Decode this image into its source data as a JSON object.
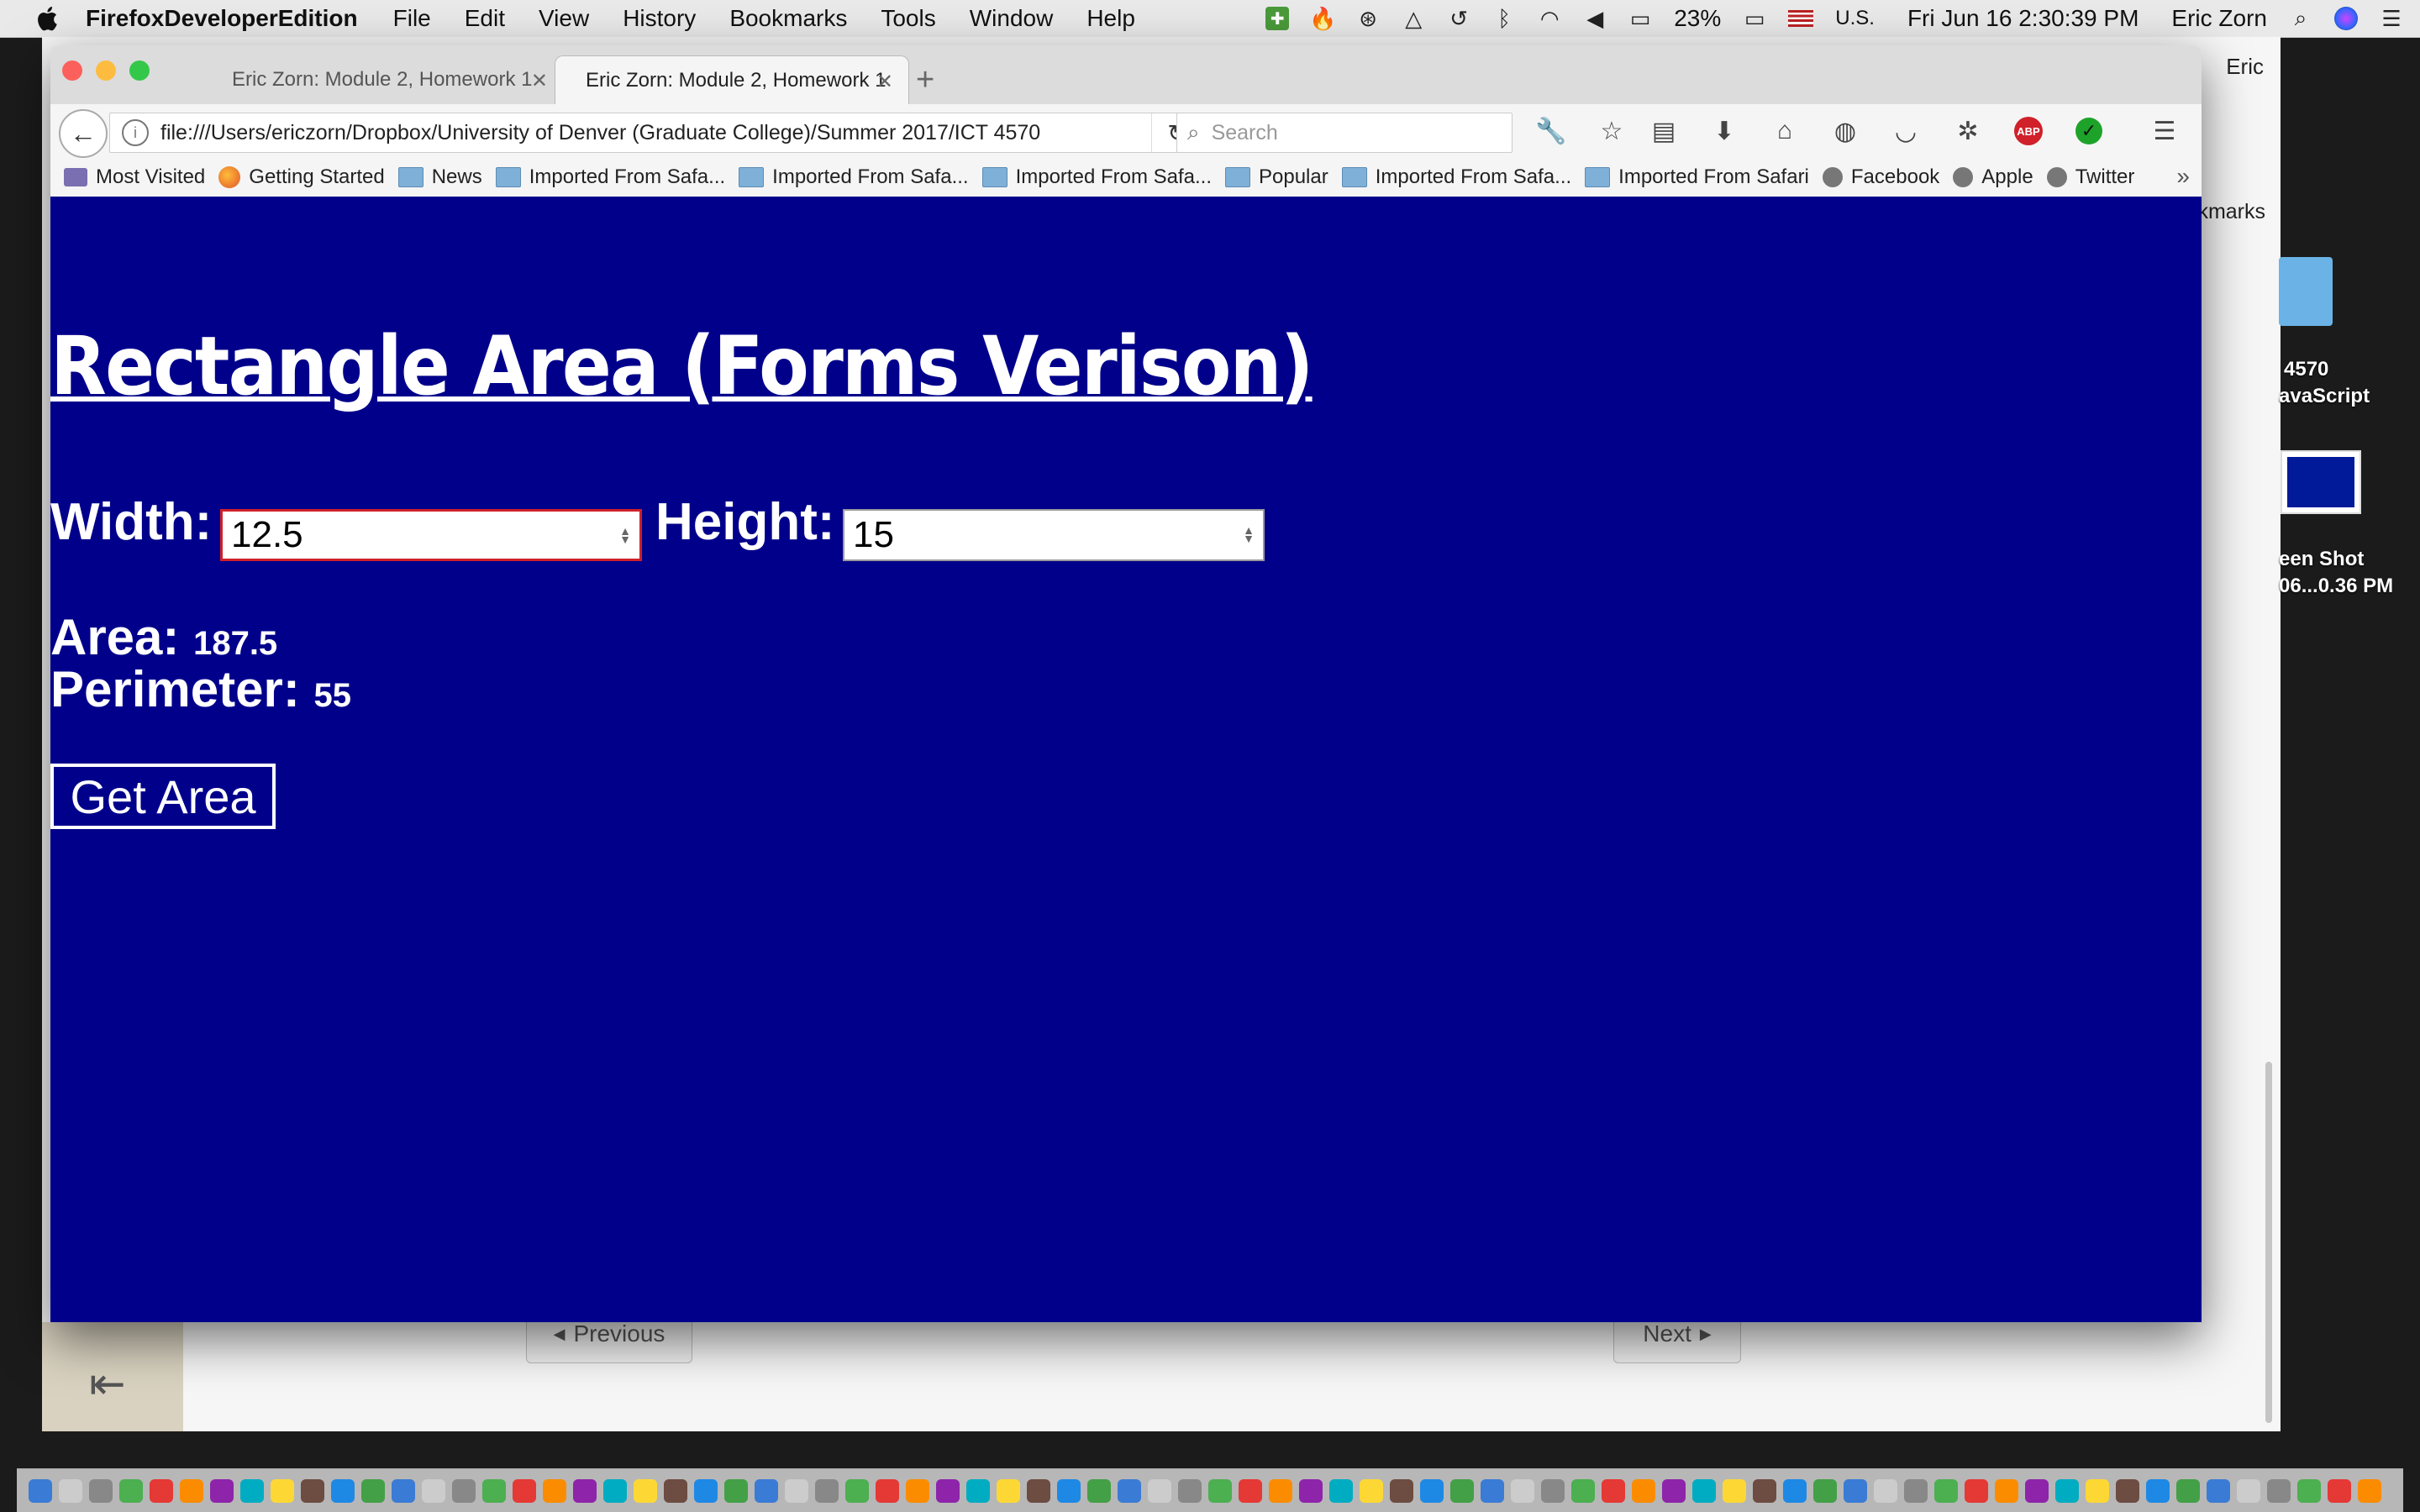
{
  "menubar": {
    "app_name": "FirefoxDeveloperEdition",
    "menus": [
      "File",
      "Edit",
      "View",
      "History",
      "Bookmarks",
      "Tools",
      "Window",
      "Help"
    ],
    "battery": "23%",
    "input_source": "U.S.",
    "clock": "Fri Jun 16  2:30:39 PM",
    "user": "Eric Zorn"
  },
  "background_window": {
    "title": "Eric",
    "bookmarks_partial": "kmarks",
    "previous_label": "Previous",
    "next_label": "Next",
    "sidebar_collapse_icon": "collapse-left-icon"
  },
  "desktop": {
    "folder_label_line1": "4570",
    "folder_label_line2": "avaScript",
    "screenshot_label_line1": "een Shot",
    "screenshot_label_line2": "06...0.36 PM"
  },
  "browser": {
    "tabs": [
      {
        "title": "Eric Zorn: Module 2, Homework 1",
        "active": false
      },
      {
        "title": "Eric Zorn: Module 2, Homework 1",
        "active": true
      }
    ],
    "url": "file:///Users/ericzorn/Dropbox/University of Denver (Graduate College)/Summer 2017/ICT 4570",
    "search_placeholder": "Search",
    "bookmarks": [
      {
        "label": "Most Visited",
        "icon": "most-visited-icon"
      },
      {
        "label": "Getting Started",
        "icon": "firefox-icon"
      },
      {
        "label": "News",
        "icon": "folder-icon"
      },
      {
        "label": "Imported From Safa...",
        "icon": "folder-icon"
      },
      {
        "label": "Imported From Safa...",
        "icon": "folder-icon"
      },
      {
        "label": "Imported From Safa...",
        "icon": "folder-icon"
      },
      {
        "label": "Popular",
        "icon": "folder-icon"
      },
      {
        "label": "Imported From Safa...",
        "icon": "folder-icon"
      },
      {
        "label": "Imported From Safari",
        "icon": "folder-icon"
      },
      {
        "label": "Facebook",
        "icon": "globe-icon"
      },
      {
        "label": "Apple",
        "icon": "globe-icon"
      },
      {
        "label": "Twitter",
        "icon": "globe-icon"
      }
    ],
    "abp_label": "ABP"
  },
  "page": {
    "title": "Rectangle Area (Forms Verison)",
    "width_label": "Width:",
    "width_value": "12.5",
    "height_label": "Height:",
    "height_value": "15",
    "area_label": "Area:",
    "area_value": "187.5",
    "perimeter_label": "Perimeter:",
    "perimeter_value": "55",
    "button_label": "Get Area",
    "background_color": "#00008b"
  }
}
